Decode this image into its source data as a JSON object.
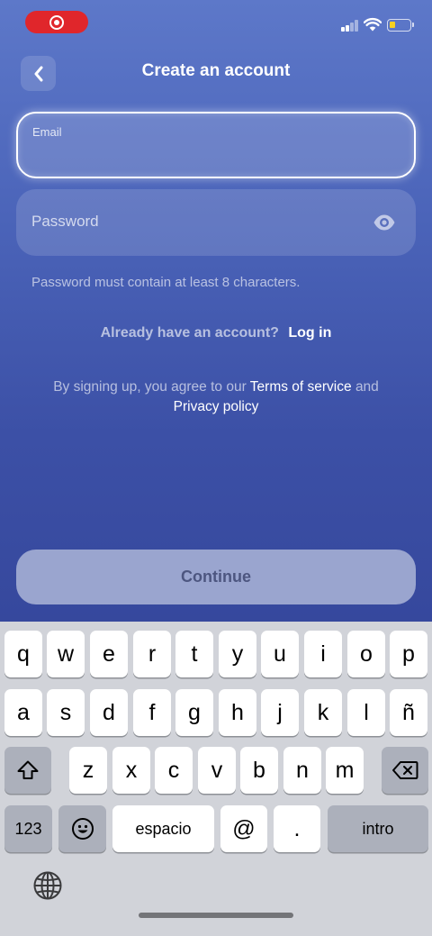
{
  "header": {
    "title": "Create an account",
    "back_icon": "chevron-left-icon"
  },
  "form": {
    "email": {
      "label": "Email",
      "value": ""
    },
    "password": {
      "placeholder": "Password",
      "toggle_icon": "eye-icon"
    },
    "password_hint": "Password must contain at least 8 characters."
  },
  "login": {
    "question": "Already have an account?",
    "link": "Log in"
  },
  "terms": {
    "prefix": "By signing up, you agree to our",
    "terms_link": "Terms of service",
    "conjunction": "and",
    "privacy_link": "Privacy policy"
  },
  "continue_label": "Continue",
  "keyboard": {
    "row1": [
      "q",
      "w",
      "e",
      "r",
      "t",
      "y",
      "u",
      "i",
      "o",
      "p"
    ],
    "row2": [
      "a",
      "s",
      "d",
      "f",
      "g",
      "h",
      "j",
      "k",
      "l",
      "ñ"
    ],
    "row3": [
      "z",
      "x",
      "c",
      "v",
      "b",
      "n",
      "m"
    ],
    "numbers_label": "123",
    "space_label": "espacio",
    "at_label": "@",
    "period_label": ".",
    "return_label": "intro",
    "shift_icon": "shift-icon",
    "delete_icon": "backspace-icon",
    "emoji_icon": "emoji-icon",
    "globe_icon": "globe-icon"
  },
  "colors": {
    "recording": "#e0262b",
    "battery": "#f5d020",
    "background_top": "#5d78c9",
    "background_bottom": "#36489d",
    "keyboard_bg": "#d1d3d9"
  }
}
